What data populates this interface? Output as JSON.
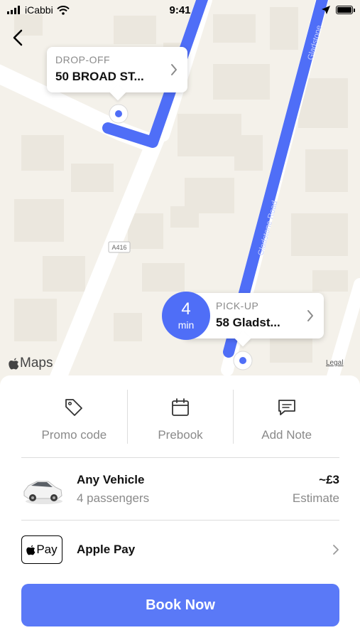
{
  "status_bar": {
    "carrier": "iCabbi",
    "time": "9:41"
  },
  "map": {
    "dropoff": {
      "label": "DROP-OFF",
      "address": "50 BROAD ST..."
    },
    "pickup": {
      "label": "PICK-UP",
      "address": "58 Gladst...",
      "eta_value": "4",
      "eta_unit": "min"
    },
    "road_labels": [
      "A416",
      "Gladstone Road",
      "Gladstone"
    ],
    "attribution": {
      "maps": "Maps",
      "legal": "Legal"
    },
    "route_color": "#4f6ef7"
  },
  "actions": [
    {
      "label": "Promo code",
      "icon": "tag-icon"
    },
    {
      "label": "Prebook",
      "icon": "calendar-icon"
    },
    {
      "label": "Add Note",
      "icon": "message-icon"
    }
  ],
  "vehicle": {
    "name": "Any Vehicle",
    "capacity": "4 passengers",
    "price": "~£3",
    "price_note": "Estimate"
  },
  "payment": {
    "badge_text": "Pay",
    "method": "Apple Pay"
  },
  "book_button": {
    "label": "Book Now",
    "color": "#5a79f7"
  }
}
